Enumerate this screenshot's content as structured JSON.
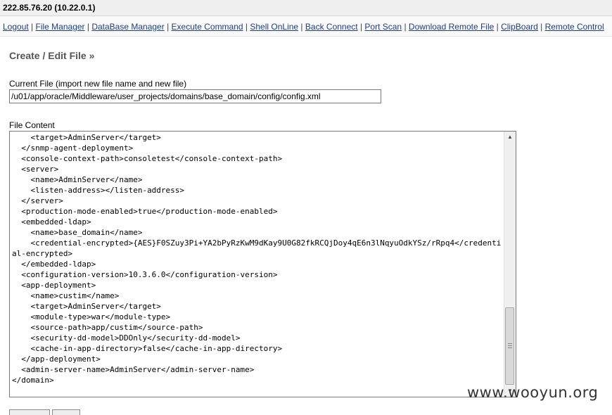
{
  "window": {
    "host": "222.85.76.20 (10.22.0.1)"
  },
  "nav": {
    "items": [
      "Logout",
      "File Manager",
      "DataBase Manager",
      "Execute Command",
      "Shell OnLine",
      "Back Connect",
      "Port Scan",
      "Download Remote File",
      "ClipBoard",
      "Remote Control"
    ],
    "separator": " | "
  },
  "page": {
    "title": "Create / Edit File »",
    "current_file_label": "Current File (import new file name and new file)",
    "current_file_value": "/u01/app/oracle/Middleware/user_projects/domains/base_domain/config/config.xml",
    "file_content_label": "File Content",
    "file_content": "    <target>AdminServer</target>\n  </snmp-agent-deployment>\n  <console-context-path>consoletest</console-context-path>\n  <server>\n    <name>AdminServer</name>\n    <listen-address></listen-address>\n  </server>\n  <production-mode-enabled>true</production-mode-enabled>\n  <embedded-ldap>\n    <name>base_domain</name>\n    <credential-encrypted>{AES}F0SZuy3Pi+YA2bPyRzKwM9dKay9U0G82fkRCQjDoy4qE6n3lNqyuOdkYSz/rRpq4</credential-encrypted>\n  </embedded-ldap>\n  <configuration-version>10.3.6.0</configuration-version>\n  <app-deployment>\n    <name>custim</name>\n    <target>AdminServer</target>\n    <module-type>war</module-type>\n    <source-path>app/custim</source-path>\n    <security-dd-model>DDOnly</security-dd-model>\n    <cache-in-app-directory>false</cache-in-app-directory>\n  </app-deployment>\n  <admin-server-name>AdminServer</admin-server-name>\n</domain>"
  },
  "scrollbar": {
    "position_fraction": 0.85
  },
  "watermark": "www.wooyun.org"
}
